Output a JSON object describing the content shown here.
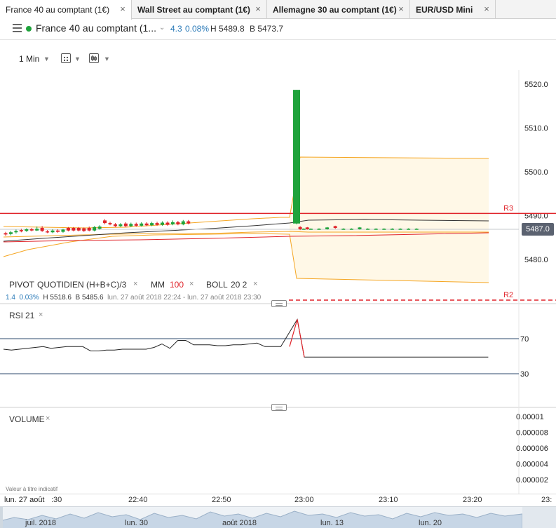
{
  "tabs": [
    {
      "label": "France 40 au comptant (1€)",
      "active": true
    },
    {
      "label": "Wall Street au comptant (1€)",
      "active": false
    },
    {
      "label": "Allemagne 30 au comptant (1€)",
      "active": false
    },
    {
      "label": "EUR/USD Mini",
      "active": false
    }
  ],
  "tab_close_glyph": "×",
  "header": {
    "instrument": "France 40 au comptant (1...",
    "change": "4.3",
    "change_pct": "0.08%",
    "high": "H 5489.8",
    "bid": "B 5473.7",
    "status_color": "#1fa33b"
  },
  "toolbar": {
    "timeframe": "1 Min",
    "icons": [
      "chart-type-icon",
      "studies-icon"
    ]
  },
  "chart_data": {
    "type": "candlestick",
    "y_axis_ticks": [
      "5520.0",
      "5510.0",
      "5500.0",
      "5490.0",
      "5480.0"
    ],
    "y_tick_values": [
      5520,
      5510,
      5500,
      5490,
      5480
    ],
    "current_price": "5487.0",
    "pivot_lines": [
      {
        "label": "R3",
        "value": 5490.5,
        "color": "#e0242a"
      },
      {
        "label": "R2",
        "value": 5471.5,
        "color": "#e0242a"
      }
    ],
    "x_ticks": [
      ":30",
      "22:40",
      "22:50",
      "23:00",
      "23:10",
      "23:20",
      "23:"
    ],
    "date_label": "lun. 27 août",
    "candles": [
      {
        "o": 5486.0,
        "c": 5485.7,
        "h": 5486.3,
        "l": 5485.4
      },
      {
        "o": 5485.8,
        "c": 5486.2,
        "h": 5486.5,
        "l": 5485.5
      },
      {
        "o": 5486.2,
        "c": 5486.5,
        "h": 5486.8,
        "l": 5485.9
      },
      {
        "o": 5486.7,
        "c": 5486.4,
        "h": 5487.0,
        "l": 5486.2
      },
      {
        "o": 5486.5,
        "c": 5486.9,
        "h": 5487.1,
        "l": 5486.3
      },
      {
        "o": 5486.9,
        "c": 5486.6,
        "h": 5487.2,
        "l": 5486.4
      },
      {
        "o": 5486.6,
        "c": 5487.0,
        "h": 5487.5,
        "l": 5486.5
      },
      {
        "o": 5487.2,
        "c": 5486.5,
        "h": 5487.6,
        "l": 5486.3
      },
      {
        "o": 5486.4,
        "c": 5486.2,
        "h": 5486.7,
        "l": 5486.0
      },
      {
        "o": 5486.2,
        "c": 5486.6,
        "h": 5486.9,
        "l": 5486.0
      },
      {
        "o": 5486.6,
        "c": 5486.3,
        "h": 5486.9,
        "l": 5486.1
      },
      {
        "o": 5486.3,
        "c": 5486.8,
        "h": 5487.0,
        "l": 5486.1
      },
      {
        "o": 5487.2,
        "c": 5486.6,
        "h": 5487.4,
        "l": 5486.4
      },
      {
        "o": 5487.2,
        "c": 5486.6,
        "h": 5487.4,
        "l": 5486.4
      },
      {
        "o": 5487.2,
        "c": 5486.6,
        "h": 5487.4,
        "l": 5486.4
      },
      {
        "o": 5487.1,
        "c": 5486.5,
        "h": 5487.3,
        "l": 5486.3
      },
      {
        "o": 5487.2,
        "c": 5486.6,
        "h": 5487.5,
        "l": 5486.4
      },
      {
        "o": 5486.6,
        "c": 5487.4,
        "h": 5487.6,
        "l": 5486.4
      },
      {
        "o": 5487.0,
        "c": 5487.5,
        "h": 5487.8,
        "l": 5486.8
      },
      {
        "o": 5488.9,
        "c": 5488.3,
        "h": 5489.2,
        "l": 5488.0
      },
      {
        "o": 5488.3,
        "c": 5488.0,
        "h": 5488.6,
        "l": 5487.8
      },
      {
        "o": 5488.0,
        "c": 5487.6,
        "h": 5488.3,
        "l": 5487.4
      },
      {
        "o": 5487.6,
        "c": 5488.0,
        "h": 5488.3,
        "l": 5487.4
      },
      {
        "o": 5488.2,
        "c": 5487.6,
        "h": 5488.5,
        "l": 5487.4
      },
      {
        "o": 5487.6,
        "c": 5488.1,
        "h": 5488.4,
        "l": 5487.4
      },
      {
        "o": 5488.1,
        "c": 5487.7,
        "h": 5488.4,
        "l": 5487.5
      },
      {
        "o": 5487.7,
        "c": 5488.2,
        "h": 5488.5,
        "l": 5487.5
      },
      {
        "o": 5488.2,
        "c": 5487.8,
        "h": 5488.5,
        "l": 5487.6
      },
      {
        "o": 5487.8,
        "c": 5488.3,
        "h": 5488.6,
        "l": 5487.6
      },
      {
        "o": 5488.3,
        "c": 5487.9,
        "h": 5488.6,
        "l": 5487.7
      },
      {
        "o": 5487.9,
        "c": 5488.4,
        "h": 5488.7,
        "l": 5487.7
      },
      {
        "o": 5488.4,
        "c": 5487.9,
        "h": 5488.7,
        "l": 5487.7
      },
      {
        "o": 5488.0,
        "c": 5488.5,
        "h": 5488.9,
        "l": 5487.8
      },
      {
        "o": 5488.5,
        "c": 5488.0,
        "h": 5488.8,
        "l": 5487.8
      },
      {
        "o": 5488.0,
        "c": 5488.7,
        "h": 5489.0,
        "l": 5487.8
      },
      {
        "o": 5488.7,
        "c": 5488.2,
        "h": 5489.0,
        "l": 5488.0
      },
      {
        "o": 5488.2,
        "c": 5518.7,
        "h": 5518.7,
        "l": 5488.0
      },
      {
        "o": 5487.4,
        "c": 5486.9,
        "h": 5487.6,
        "l": 5486.7
      },
      {
        "o": 5487.0,
        "c": 5487.0,
        "h": 5487.1,
        "l": 5486.9
      },
      {
        "o": 5487.3,
        "c": 5486.9,
        "h": 5487.4,
        "l": 5486.8
      },
      {
        "o": 5487.0,
        "c": 5487.0,
        "h": 5487.1,
        "l": 5486.9
      },
      {
        "o": 5487.0,
        "c": 5487.0,
        "h": 5487.1,
        "l": 5486.9
      },
      {
        "o": 5486.9,
        "c": 5487.3,
        "h": 5487.4,
        "l": 5486.8
      },
      {
        "o": 5487.6,
        "c": 5487.2,
        "h": 5487.7,
        "l": 5487.0
      },
      {
        "o": 5487.0,
        "c": 5487.0,
        "h": 5487.1,
        "l": 5486.9
      },
      {
        "o": 5487.0,
        "c": 5487.0,
        "h": 5487.1,
        "l": 5486.9
      },
      {
        "o": 5486.9,
        "c": 5487.3,
        "h": 5487.4,
        "l": 5486.8
      },
      {
        "o": 5487.0,
        "c": 5487.0,
        "h": 5487.1,
        "l": 5486.9
      },
      {
        "o": 5487.0,
        "c": 5487.0,
        "h": 5487.1,
        "l": 5486.9
      },
      {
        "o": 5487.0,
        "c": 5487.0,
        "h": 5487.1,
        "l": 5486.9
      },
      {
        "o": 5487.0,
        "c": 5487.0,
        "h": 5487.1,
        "l": 5486.9
      },
      {
        "o": 5487.0,
        "c": 5487.0,
        "h": 5487.1,
        "l": 5486.9
      },
      {
        "o": 5487.0,
        "c": 5487.0,
        "h": 5487.1,
        "l": 5486.9
      },
      {
        "o": 5487.0,
        "c": 5487.0,
        "h": 5487.1,
        "l": 5486.9
      }
    ],
    "up_color": "#1fa33b",
    "down_color": "#e0242a",
    "boll_color": "#f5a623",
    "ma_color": "#333333",
    "rsi": {
      "label": "RSI",
      "period": "21",
      "levels": [
        "70",
        "30"
      ],
      "level_values": [
        70,
        30
      ],
      "values": [
        58,
        57,
        58,
        59,
        60,
        61,
        59,
        60,
        61,
        61,
        61,
        56,
        56,
        57,
        57,
        58,
        58,
        58,
        58,
        60,
        64,
        59,
        68,
        68,
        63,
        63,
        63,
        62,
        62,
        63,
        63,
        64,
        65,
        61,
        61,
        61,
        92,
        49,
        49,
        49,
        49,
        49,
        49,
        49,
        49,
        49,
        49,
        49,
        49,
        49,
        49,
        49,
        49,
        49
      ]
    },
    "volume": {
      "label": "VOLUME",
      "ticks": [
        "0.00001",
        "0.000008",
        "0.000006",
        "0.000004",
        "0.000002"
      ]
    }
  },
  "studies": {
    "pivot_label": "PIVOT",
    "pivot_params": "QUOTIDIEN  (H+B+C)/3",
    "mm_label": "MM",
    "mm_value": "100",
    "boll_label": "BOLL",
    "boll_params": "20  2",
    "close_glyph": "×"
  },
  "infoline": {
    "change": "1.4",
    "change_pct": "0.03%",
    "high": "H 5518.6",
    "low": "B 5485.6",
    "range": "lun. 27 août 2018 22:24 - lun. 27 août 2018 23:30"
  },
  "disclaimer": "Valeur à titre indicatif",
  "navigator": {
    "labels": [
      "juil. 2018",
      "lun. 30",
      "août 2018",
      "lun. 13",
      "lun. 20"
    ]
  }
}
